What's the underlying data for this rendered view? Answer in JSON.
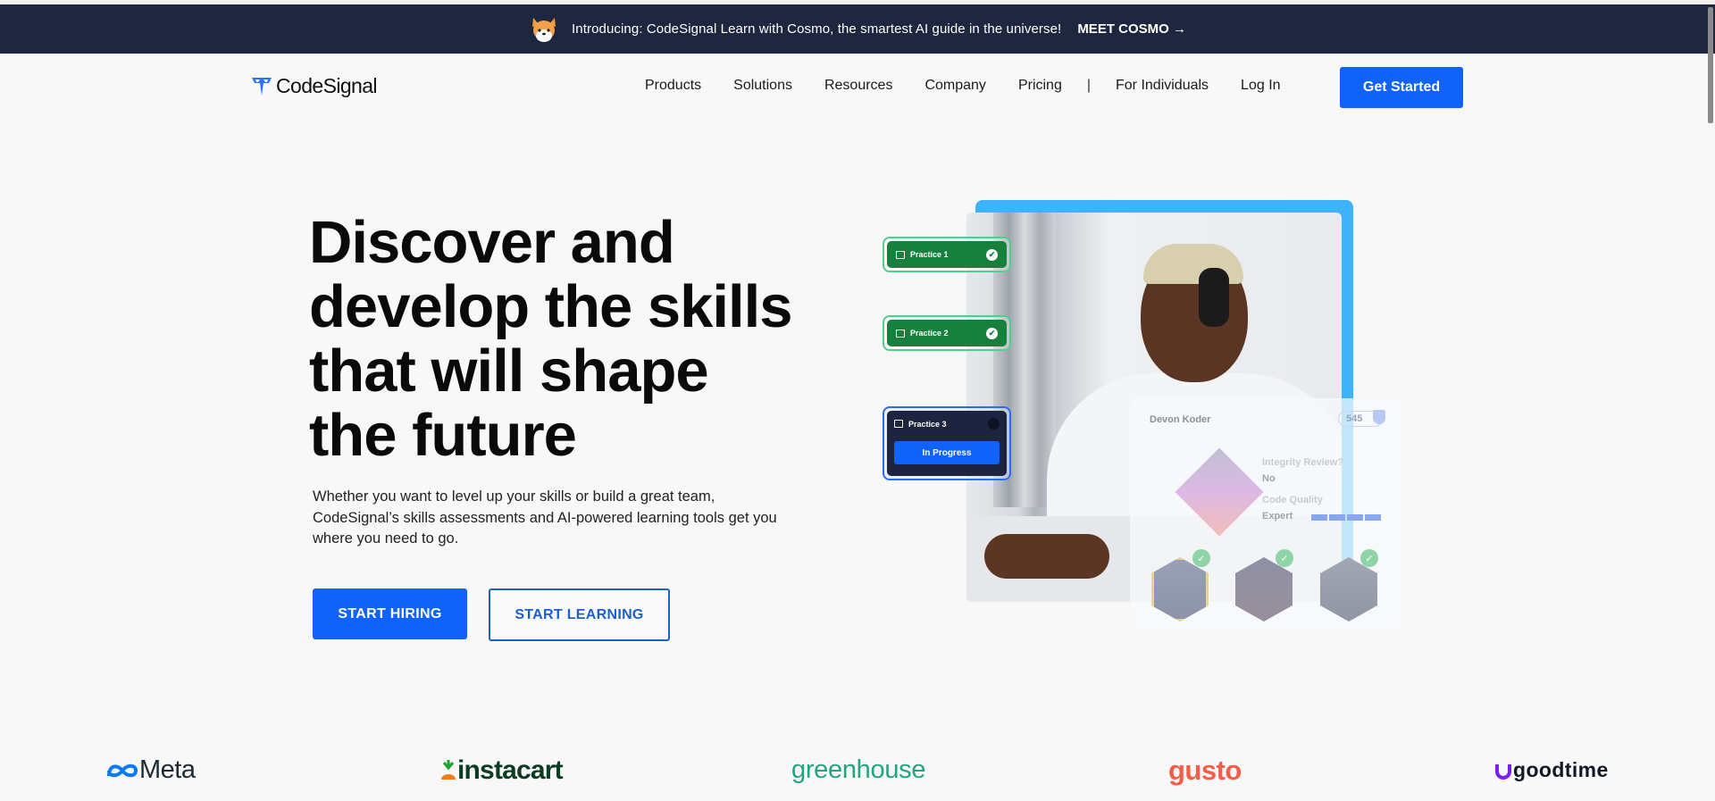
{
  "announcement": {
    "mascot_icon": "corgi-mascot-icon",
    "message": "Introducing: CodeSignal Learn with Cosmo, the smartest AI guide in the universe!",
    "cta": "MEET COSMO →"
  },
  "nav": {
    "brand": "CodeSignal",
    "items": [
      "Products",
      "Solutions",
      "Resources",
      "Company",
      "Pricing"
    ],
    "separator": "|",
    "for_individuals": "For Individuals",
    "login": "Log In",
    "get_started": "Get Started"
  },
  "hero": {
    "title": "Discover and develop the skills that will shape the future",
    "description": "Whether you want to level up your skills or build a great team, CodeSignal’s skills assessments and AI-powered learning tools get you where you need to go.",
    "primary_cta": "START HIRING",
    "secondary_cta": "START LEARNING"
  },
  "illustration": {
    "practices": [
      {
        "label": "Practice 1",
        "status": "complete"
      },
      {
        "label": "Practice 2",
        "status": "complete"
      },
      {
        "label": "Practice 3",
        "status": "In Progress"
      }
    ],
    "profile_card": {
      "name": "Devon Koder",
      "score": "545",
      "integrity_label": "Integrity Review?",
      "integrity_value": "No",
      "quality_label": "Code Quality",
      "quality_value": "Expert",
      "quality_level": "4 of 4"
    },
    "badges": [
      "database-badge-icon",
      "analytics-badge-icon",
      "terminal-badge-icon"
    ]
  },
  "logos": [
    "Meta",
    "instacart",
    "greenhouse",
    "gusto",
    "goodtime"
  ],
  "colors": {
    "brand_blue": "#1062fb",
    "announce_bg": "#1e2640",
    "practice_green": "#17803d",
    "page_bg": "#f8f8f8"
  }
}
